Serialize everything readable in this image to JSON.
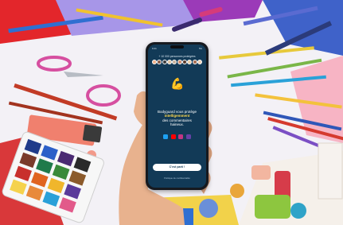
{
  "scene": {
    "description_colors": {
      "table": "#f3f1f6",
      "phone_screen": "#123a57",
      "accent_yellow": "#ffd84d",
      "paper_blue": "#3f62c9",
      "paper_red": "#e3262b",
      "paper_purple": "#a796e8"
    }
  },
  "phone": {
    "status_time": "9:41",
    "status_signal": "5G",
    "counter_text": "+ 10 000 personnes protégées",
    "headline_line1": "Bodyguard vous protège",
    "headline_emph": "intelligemment",
    "headline_line3": "des commentaires",
    "headline_line4": "haineux.",
    "cta_label": "C'est parti !",
    "privacy_label": "Politique de confidentialité",
    "app_colors": [
      "#1da1f2",
      "#ff0000",
      "#c13584",
      "#6441a5"
    ],
    "avatar_colors": [
      "#f2b38a",
      "#8a5a44",
      "#3b3b3b",
      "#e0c3a0",
      "#c9b29b",
      "#d18c6b",
      "#5b3a2a",
      "#eacda6",
      "#a66b4f",
      "#f0d2b6"
    ]
  }
}
